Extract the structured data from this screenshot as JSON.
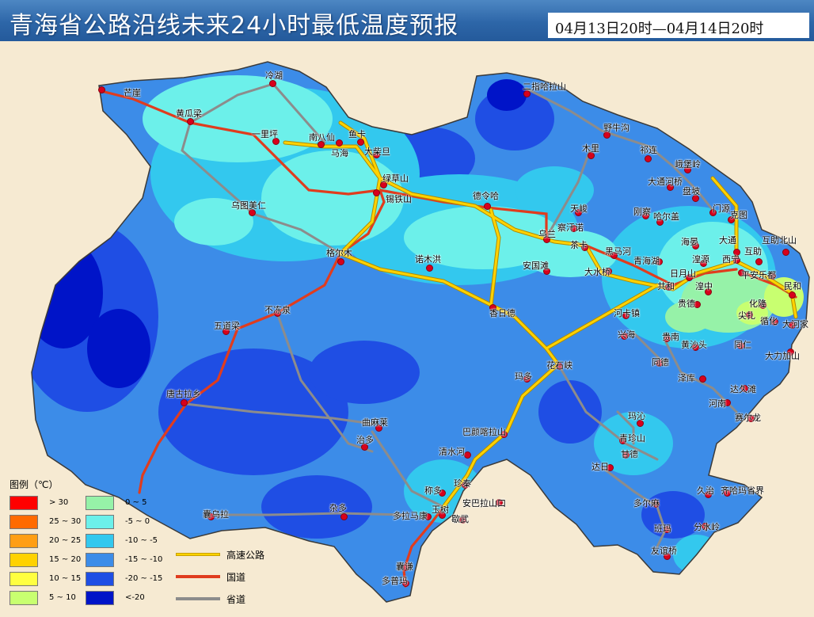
{
  "header": {
    "title": "青海省公路沿线未来24小时最低温度预报",
    "time_range": "04月13日20时—04月14日20时"
  },
  "legend": {
    "title": "图例（℃）",
    "items": [
      {
        "label": "> 30",
        "color": "#ff0000"
      },
      {
        "label": "25 ~ 30",
        "color": "#ff6a00"
      },
      {
        "label": "20 ~ 25",
        "color": "#ff9e14"
      },
      {
        "label": "15 ~ 20",
        "color": "#ffd200"
      },
      {
        "label": "10 ~ 15",
        "color": "#ffff40"
      },
      {
        "label": "5 ~ 10",
        "color": "#c8ff70"
      },
      {
        "label": "0 ~ 5",
        "color": "#96f2a8"
      },
      {
        "label": "-5 ~ 0",
        "color": "#6cf0ea"
      },
      {
        "label": "-10 ~ -5",
        "color": "#33c8ee"
      },
      {
        "label": "-15 ~ -10",
        "color": "#3c8ce8"
      },
      {
        "label": "-20 ~ -15",
        "color": "#1f4ee4"
      },
      {
        "label": "<-20",
        "color": "#0014c8"
      }
    ],
    "roads": [
      {
        "label": "高速公路",
        "color": "#ffd200",
        "outline": "#c8a000"
      },
      {
        "label": "国道",
        "color": "#e03c1e"
      },
      {
        "label": "省道",
        "color": "#8c8c8c"
      }
    ]
  },
  "cities": [
    "冷湖",
    "二指哈拉山",
    "芒崖",
    "黄瓜梁",
    "一里坪",
    "南八仙",
    "鱼卡",
    "马海",
    "大柴旦",
    "野牛沟",
    "木里",
    "祁连",
    "峨堡岭",
    "大通河桥",
    "盘坡",
    "门源",
    "克图",
    "绿草山",
    "锡铁山",
    "德令哈",
    "天峻",
    "刚察",
    "哈尔盖",
    "乌图美仁",
    "察汗诺",
    "乌兰",
    "海晏",
    "大通",
    "互助北山",
    "格尔木",
    "诺木洪",
    "茶卡",
    "黑马河",
    "青海湖",
    "湟源",
    "西宁",
    "互助",
    "安国滩",
    "大水桥",
    "日月山",
    "平安",
    "乐都",
    "民和",
    "共和",
    "湟中",
    "贵德",
    "化隆",
    "尖扎",
    "循化",
    "大河家",
    "不冻泉",
    "香日德",
    "河卡镇",
    "五道梁",
    "兴海",
    "贵南",
    "黄沙头",
    "同仁",
    "大力加山",
    "花石峡",
    "同德",
    "玛多",
    "泽库",
    "达久滩",
    "唐古拉乡",
    "河南",
    "赛尔龙",
    "玛沁",
    "曲麻莱",
    "巴颜喀拉山",
    "青珍山",
    "治多",
    "甘德",
    "清水河",
    "达日",
    "珍秦",
    "称多",
    "安巴拉山口",
    "久治",
    "齐哈玛省界",
    "玉树",
    "杂多",
    "歇武",
    "多尔麻",
    "囊乌拉",
    "多拉马康",
    "班玛",
    "分水岭",
    "友谊桥",
    "囊谦",
    "多普玛"
  ]
}
